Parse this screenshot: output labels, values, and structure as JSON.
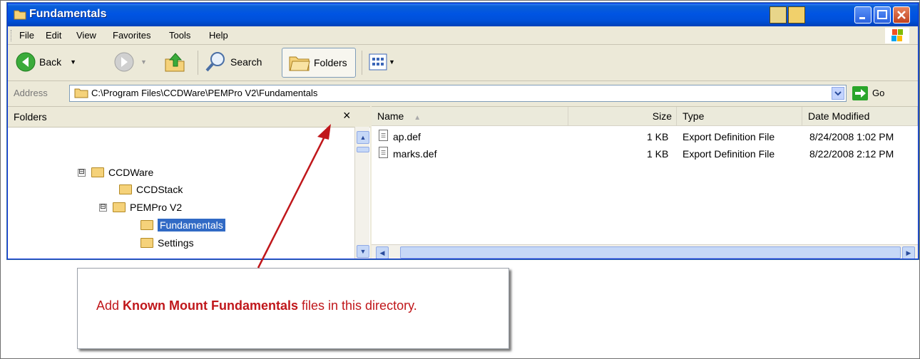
{
  "window": {
    "title": "Fundamentals"
  },
  "menu": [
    "File",
    "Edit",
    "View",
    "Favorites",
    "Tools",
    "Help"
  ],
  "toolbar": {
    "back_label": "Back",
    "search_label": "Search",
    "folders_label": "Folders"
  },
  "address": {
    "label": "Address",
    "path": "C:\\Program Files\\CCDWare\\PEMPro V2\\Fundamentals",
    "go_label": "Go"
  },
  "folders_pane": {
    "title": "Folders",
    "close_glyph": "×",
    "tree": [
      {
        "label": "CCDWare",
        "expander": "⊟"
      },
      {
        "label": "CCDStack"
      },
      {
        "label": "PEMPro V2",
        "expander": "⊟"
      },
      {
        "label": "Fundamentals",
        "selected": true
      },
      {
        "label": "Settings"
      }
    ]
  },
  "files_pane": {
    "columns": [
      "Name",
      "Size",
      "Type",
      "Date Modified"
    ],
    "rows": [
      {
        "name": "ap.def",
        "size": "1 KB",
        "type": "Export Definition File",
        "modified": "8/24/2008 1:02 PM"
      },
      {
        "name": "marks.def",
        "size": "1 KB",
        "type": "Export Definition File",
        "modified": "8/22/2008 2:12 PM"
      }
    ]
  },
  "callout": {
    "prefix": "Add ",
    "emphasis": "Known Mount Fundamentals",
    "suffix": " files in this directory.",
    "color": "#c0171b"
  },
  "icons": [
    "folder-icon",
    "back-arrow-icon",
    "forward-arrow-icon",
    "up-folder-icon",
    "search-magnifier-icon",
    "folders-icon",
    "views-icon",
    "go-arrow-icon",
    "file-icon",
    "windows-logo-icon"
  ]
}
